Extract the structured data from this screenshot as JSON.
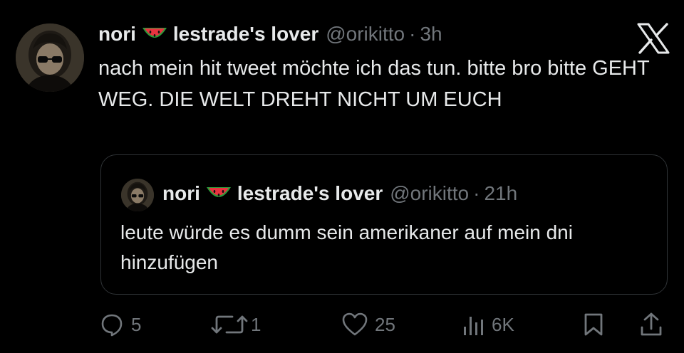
{
  "tweet": {
    "display_name": "nori",
    "display_name_suffix": "lestrade's lover",
    "handle": "@orikitto",
    "separator": "·",
    "time": "3h",
    "text": "nach mein hit tweet möchte ich das tun. bitte bro bitte GEHT WEG. DIE WELT DREHT NICHT UM EUCH"
  },
  "quoted_tweet": {
    "display_name": "nori",
    "display_name_suffix": "lestrade's lover",
    "handle": "@orikitto",
    "separator": "·",
    "time": "21h",
    "text": "leute würde es dumm sein amerikaner auf mein dni hinzufügen"
  },
  "actions": {
    "replies": "5",
    "reposts": "1",
    "likes": "25",
    "views": "6K"
  },
  "icons": {
    "name_emoji": "watermelon-icon",
    "platform": "x-logo-icon",
    "reply": "reply-icon",
    "repost": "repost-icon",
    "like": "heart-icon",
    "views": "views-icon",
    "bookmark": "bookmark-icon",
    "share": "share-icon"
  },
  "colors": {
    "background": "#000000",
    "text_primary": "#e7e9ea",
    "text_secondary": "#71767b",
    "border": "#2f3336"
  }
}
